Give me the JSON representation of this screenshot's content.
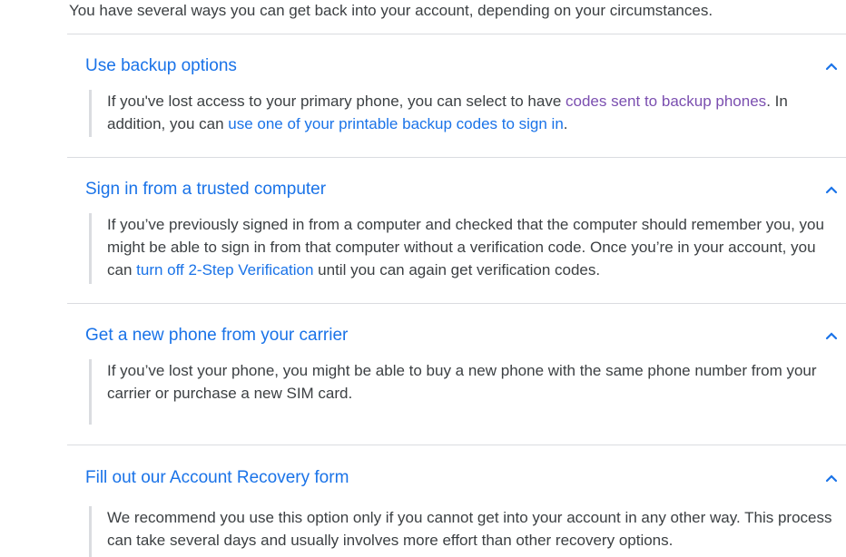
{
  "intro_text": "You have several ways you can get back into your account, depending on your circumstances.",
  "colors": {
    "accent": "#1a73e8",
    "visited_link": "#7b4fb0",
    "body_text": "#3c4043",
    "divider": "#dadce0"
  },
  "sections": [
    {
      "title": "Use backup options",
      "expanded": true,
      "body": {
        "t1": "If you've lost access to your primary phone, you can select to have ",
        "link1": "codes sent to backup phones",
        "t2": ". In addition, you can ",
        "link2": "use one of your printable backup codes to sign in",
        "t3": "."
      }
    },
    {
      "title": "Sign in from a trusted computer",
      "expanded": true,
      "body": {
        "t1": "If you’ve previously signed in from a computer and checked that the computer should remember you, you might be able to sign in from that computer without a verification code. Once you’re in your account, you can ",
        "link1": "turn off 2-Step Verification",
        "t2": " until you can again get verification codes."
      }
    },
    {
      "title": "Get a new phone from your carrier",
      "expanded": true,
      "body": {
        "t1": "If you’ve lost your phone, you might be able to buy a new phone with the same phone number from your carrier or purchase a new SIM card."
      }
    },
    {
      "title": "Fill out our Account Recovery form",
      "expanded": true,
      "body": {
        "t1": "We recommend you use this option only if you cannot get into your account in any other way. This process can take several days and usually involves more effort than other recovery options."
      }
    }
  ],
  "icons": {
    "chevron": "chevron-up-icon"
  }
}
